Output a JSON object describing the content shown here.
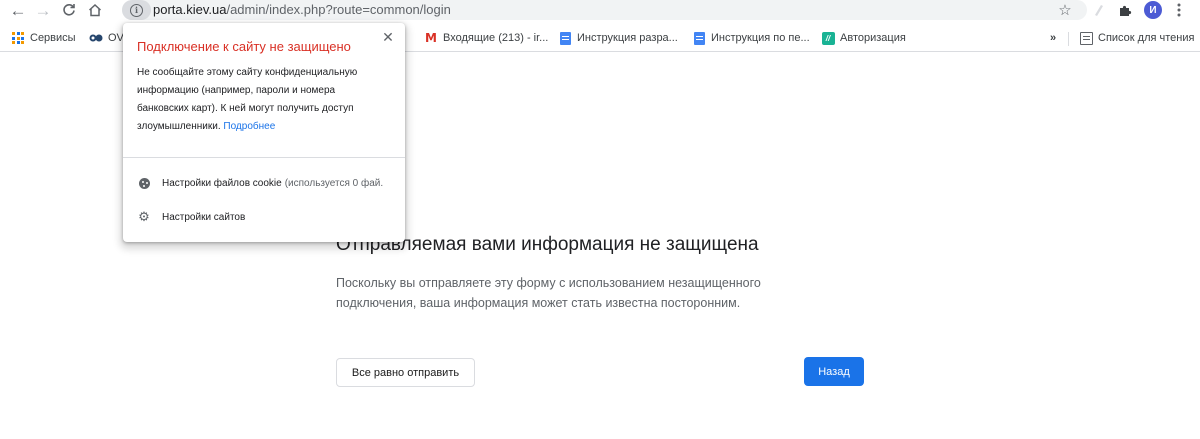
{
  "browser": {
    "url_host": "porta.kiev.ua",
    "url_path": "/admin/index.php?route=common/login",
    "avatar_letter": "И",
    "icons": {
      "back": "arrow-left-icon",
      "forward": "arrow-right-icon",
      "reload": "reload-icon",
      "home": "home-icon",
      "site_info": "info-icon",
      "bookmark_star": "star-icon",
      "extensions": "puzzle-icon",
      "menu": "kebab-menu-icon"
    }
  },
  "bookmarks": {
    "items": [
      {
        "label": "Сервисы",
        "icon": "apps-grid-icon"
      },
      {
        "label": "OV",
        "icon": "ov-icon"
      },
      {
        "label": "Входящие (213) - ir...",
        "icon": "gmail-icon"
      },
      {
        "label": "Инструкция разра...",
        "icon": "docs-icon"
      },
      {
        "label": "Инструкция по пе...",
        "icon": "docs-icon"
      },
      {
        "label": "Авторизация",
        "icon": "auth-app-icon"
      }
    ],
    "overflow_label": "»",
    "reading_list": "Список для чтения"
  },
  "popup": {
    "title": "Подключение к сайту не защищено",
    "body": "Не сообщайте этому сайту конфиденциальную информацию (например, пароли и номера банковских карт). К ней могут получить доступ злоумышленники.",
    "learn_more": "Подробнее",
    "cookie_label": "Настройки файлов cookie",
    "cookie_note": "(используется 0 фай.",
    "site_settings_label": "Настройки сайтов"
  },
  "page": {
    "title": "Отправляемая вами информация не защищена",
    "body": "Поскольку вы отправляете эту форму с использованием незащищенного подключения, ваша информация может стать известна посторонним.",
    "send_anyway": "Все равно отправить",
    "back": "Назад"
  },
  "colors": {
    "warning_title": "#d93025",
    "primary_button": "#1a73e8",
    "link": "#1a73e8",
    "avatar": "#4c5bd4"
  }
}
